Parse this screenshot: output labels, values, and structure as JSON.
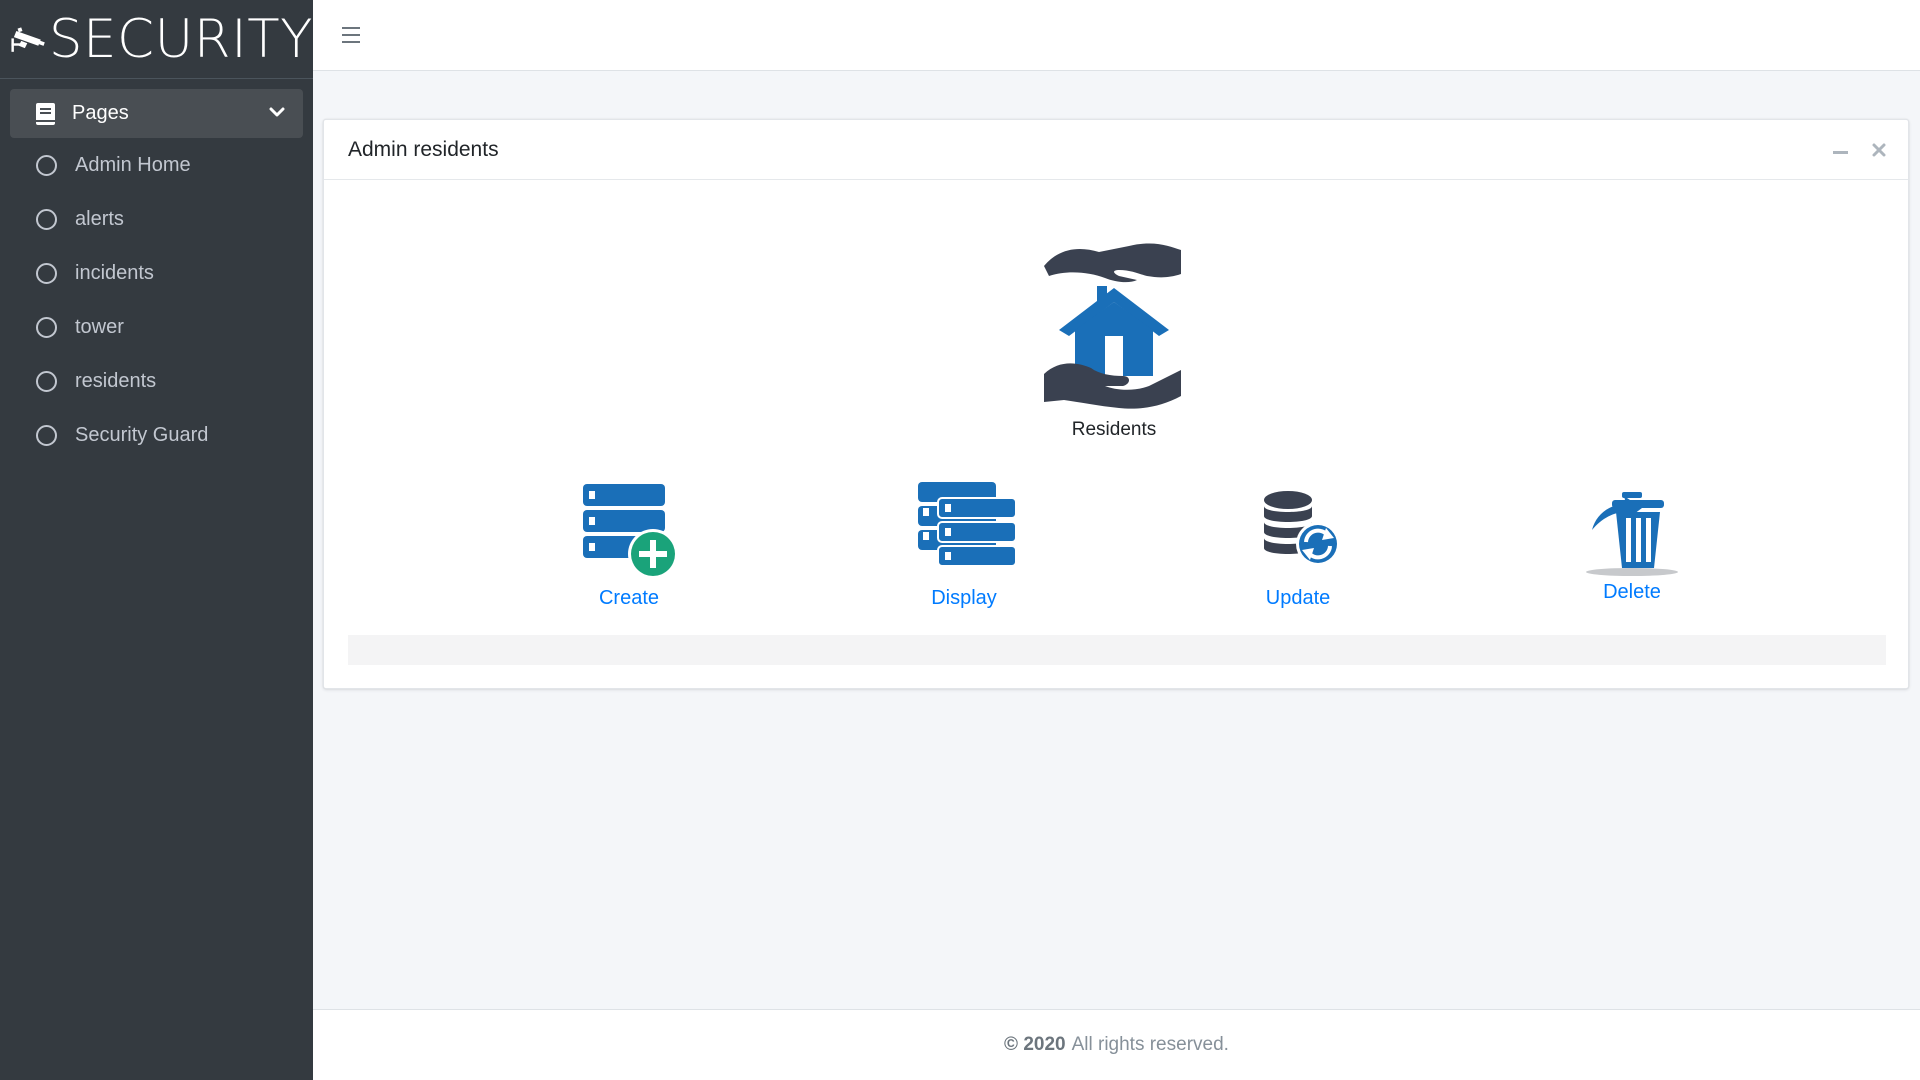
{
  "brand": {
    "name": "SECURITY",
    "logo_icon": "security-camera-icon"
  },
  "sidebar": {
    "section": {
      "label": "Pages",
      "icon": "book-icon",
      "toggle_icon": "chevron-down-icon"
    },
    "items": [
      {
        "label": "Admin Home"
      },
      {
        "label": "alerts"
      },
      {
        "label": "incidents"
      },
      {
        "label": "tower"
      },
      {
        "label": "residents"
      },
      {
        "label": "Security Guard"
      }
    ]
  },
  "topbar": {
    "menu_icon": "hamburger-icon"
  },
  "card": {
    "title": "Admin residents",
    "tools": {
      "minimize_icon": "minus-icon",
      "close_icon": "close-icon"
    },
    "hero": {
      "label": "Residents",
      "icon": "hands-house-icon"
    },
    "actions": [
      {
        "label": "Create",
        "icon": "database-add-icon"
      },
      {
        "label": "Display",
        "icon": "database-list-icon"
      },
      {
        "label": "Update",
        "icon": "database-refresh-icon"
      },
      {
        "label": "Delete",
        "icon": "trash-icon"
      }
    ]
  },
  "footer": {
    "year": "© 2020",
    "text": "All rights reserved."
  },
  "colors": {
    "sidebar_bg": "#343a40",
    "link": "#007bff",
    "icon_blue": "#1a6fb8",
    "icon_dark": "#3a4150",
    "green": "#1aa37a"
  }
}
